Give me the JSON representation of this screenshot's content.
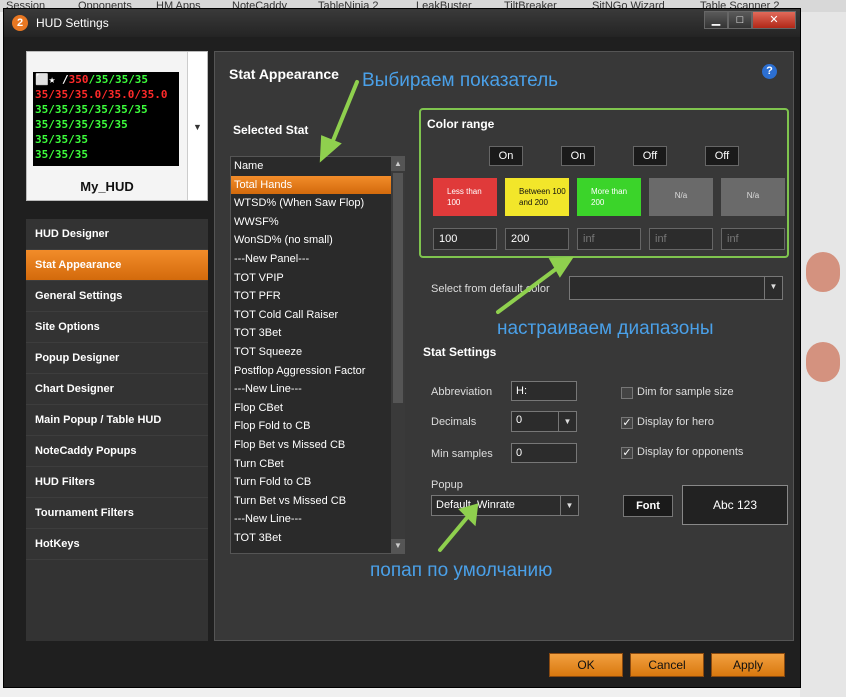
{
  "window": {
    "title": "HUD Settings",
    "app_icon_text": "2"
  },
  "hud_profile": {
    "name": "My_HUD",
    "preview_lines": [
      {
        "parts": [
          {
            "t": "⬜★ /",
            "c": "hp-white"
          },
          {
            "t": "350",
            "c": "hp-red"
          },
          {
            "t": "/35/35/35",
            "c": "hp-green"
          }
        ]
      },
      {
        "parts": [
          {
            "t": "35/35/35.0/35.0/35.0",
            "c": "hp-red"
          }
        ]
      },
      {
        "parts": [
          {
            "t": "35/35/35/35/35/35",
            "c": "hp-green"
          }
        ]
      },
      {
        "parts": [
          {
            "t": "35/35/35/35/35",
            "c": "hp-green"
          }
        ]
      },
      {
        "parts": [
          {
            "t": "35/35/35",
            "c": "hp-green"
          }
        ]
      },
      {
        "parts": [
          {
            "t": "35/35/35",
            "c": "hp-green"
          }
        ]
      }
    ]
  },
  "nav": {
    "items": [
      {
        "label": "HUD Designer",
        "active": false
      },
      {
        "label": "Stat Appearance",
        "active": true
      },
      {
        "label": "General Settings",
        "active": false
      },
      {
        "label": "Site Options",
        "active": false
      },
      {
        "label": "Popup Designer",
        "active": false
      },
      {
        "label": "Chart Designer",
        "active": false
      },
      {
        "label": "Main Popup / Table HUD",
        "active": false
      },
      {
        "label": "NoteCaddy Popups",
        "active": false
      },
      {
        "label": "HUD Filters",
        "active": false
      },
      {
        "label": "Tournament Filters",
        "active": false
      },
      {
        "label": "HotKeys",
        "active": false
      }
    ]
  },
  "main": {
    "title": "Stat Appearance",
    "help_icon": "?",
    "selected_stat_label": "Selected Stat",
    "stat_list": [
      "Name",
      "Total Hands",
      "WTSD% (When Saw Flop)",
      "WWSF%",
      "WonSD% (no small)",
      "---New Panel---",
      "TOT VPIP",
      "TOT PFR",
      "TOT Cold Call Raiser",
      "TOT 3Bet",
      "TOT Squeeze",
      "Postflop Aggression Factor",
      "---New Line---",
      "Flop CBet",
      "Flop Fold to CB",
      "Flop Bet vs Missed CB",
      "Turn CBet",
      "Turn Fold to CB",
      "Turn Bet vs Missed CB",
      "---New Line---",
      "TOT 3Bet"
    ],
    "selected_index": 1
  },
  "color_range": {
    "label": "Color range",
    "toggles": [
      "On",
      "On",
      "Off",
      "Off"
    ],
    "swatches": [
      {
        "text": "Less than 100",
        "bg": "#e03a3a",
        "fg": "#ffffff"
      },
      {
        "text": "Between 100 and 200",
        "bg": "#f2e62a",
        "fg": "#111111"
      },
      {
        "text": "More than 200",
        "bg": "#3bd42a",
        "fg": "#ffffff"
      },
      {
        "text": "N/a",
        "bg": "#6a6a6a",
        "fg": "#dddddd"
      },
      {
        "text": "N/a",
        "bg": "#6a6a6a",
        "fg": "#dddddd"
      }
    ],
    "inputs": [
      "100",
      "200",
      "inf",
      "inf",
      "inf"
    ],
    "default_color_label": "Select from default color",
    "default_color_value": ""
  },
  "stat_settings": {
    "label": "Stat Settings",
    "abbreviation_label": "Abbreviation",
    "abbreviation_value": "H:",
    "decimals_label": "Decimals",
    "decimals_value": "0",
    "min_samples_label": "Min samples",
    "min_samples_value": "0",
    "popup_label": "Popup",
    "popup_value": "Default_Winrate",
    "dim_label": "Dim for sample size",
    "dim_checked": false,
    "hero_label": "Display for hero",
    "hero_checked": true,
    "opponents_label": "Display for opponents",
    "opponents_checked": true,
    "font_button": "Font",
    "font_preview": "Abc 123"
  },
  "annotations": {
    "choose_stat": "Выбираем показатель",
    "set_ranges": "настраиваем диапазоны",
    "default_popup": "попап по умолчанию"
  },
  "footer": {
    "ok": "OK",
    "cancel": "Cancel",
    "apply": "Apply"
  },
  "background_strip": [
    "Session",
    "Opponents",
    "HM Apps",
    "NoteCaddy",
    "TableNinja 2",
    "LeakBuster",
    "TiltBreaker",
    "SitNGo Wizard",
    "Table Scanner 2"
  ],
  "colors": {
    "accent_orange": "#e8801a",
    "annotation_blue": "#4aa0e8",
    "annotation_green": "#8fd04e",
    "window_bg": "#1f1f1f",
    "panel_bg": "#383838"
  }
}
